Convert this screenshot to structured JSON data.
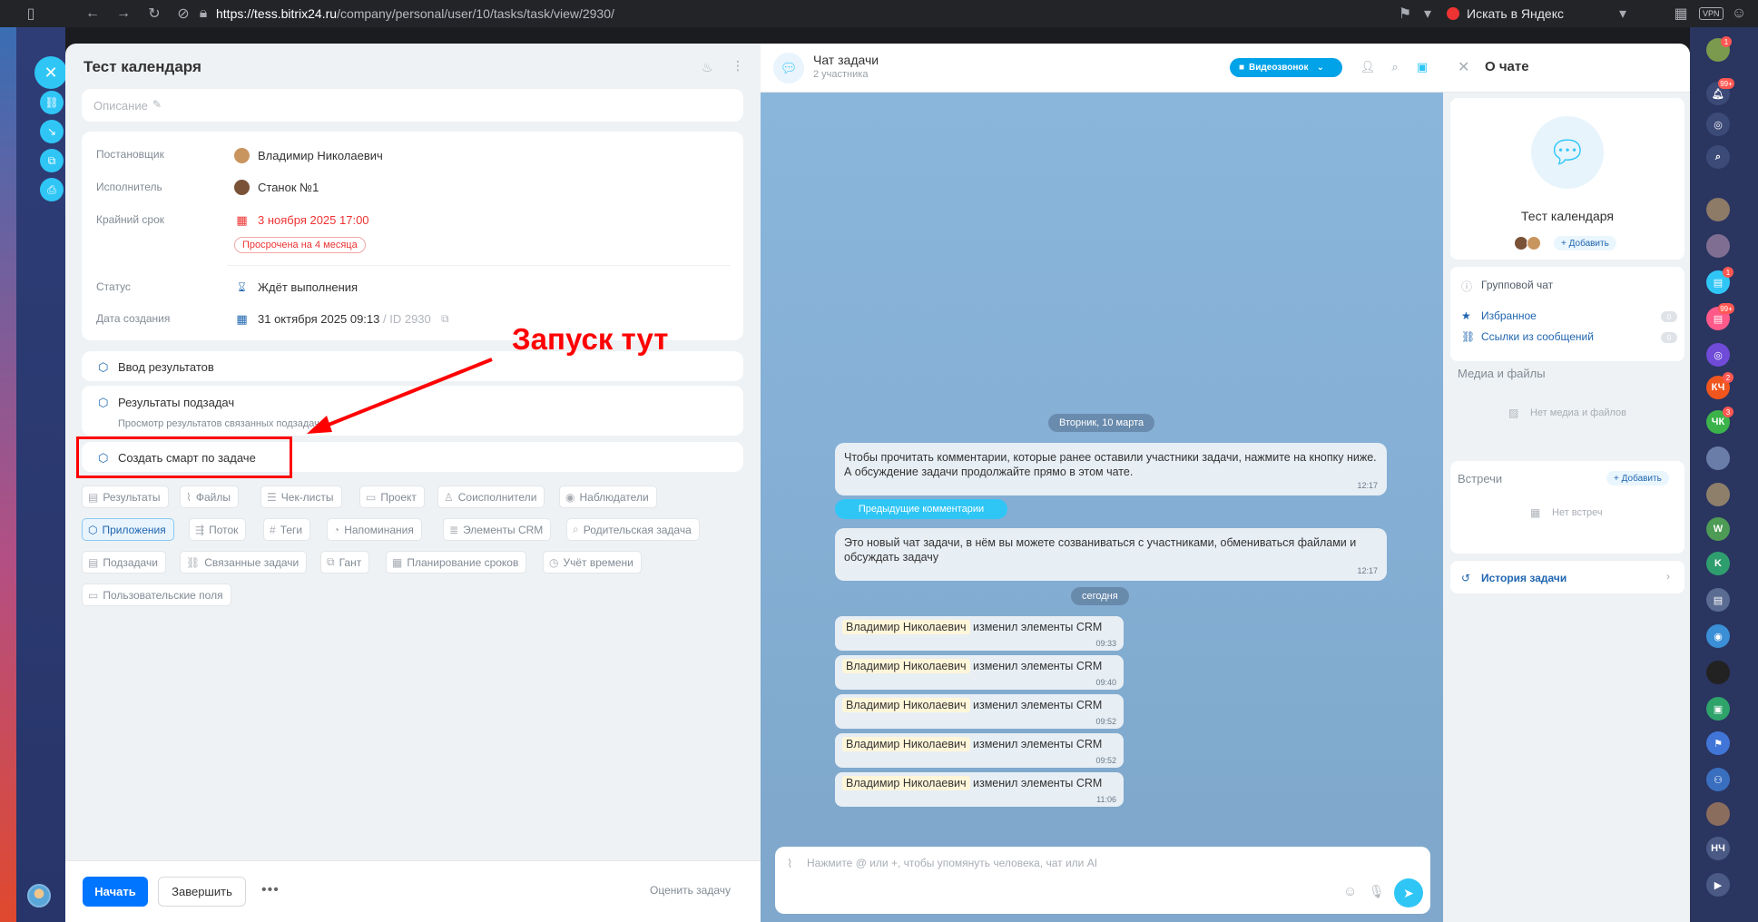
{
  "browser": {
    "url_host": "https://tess.bitrix24.ru",
    "url_path": "/company/personal/user/10/tasks/task/view/2930/",
    "search_engine": "Искать в Яндекс",
    "vpn": "VPN"
  },
  "task": {
    "title": "Тест календаря",
    "description_placeholder": "Описание",
    "fields": {
      "creator_label": "Постановщик",
      "creator_value": "Владимир Николаевич",
      "assignee_label": "Исполнитель",
      "assignee_value": "Станок №1",
      "deadline_label": "Крайний срок",
      "deadline_value": "3 ноября 2025 17:00",
      "overdue_badge": "Просрочена на 4 месяца",
      "status_label": "Статус",
      "status_value": "Ждёт выполнения",
      "created_label": "Дата создания",
      "created_value": "31 октября 2025 09:13",
      "id_value": "/ ID 2930"
    },
    "blocks": {
      "results_input": "Ввод результатов",
      "subtask_results": "Результаты подзадач",
      "subtask_results_sub": "Просмотр результатов связанных подзадач",
      "create_smart": "Создать смарт по задаче"
    },
    "annotation": "Запуск тут",
    "chips_row1": [
      "Результаты",
      "Файлы",
      "Чек-листы",
      "Проект",
      "Соисполнители",
      "Наблюдатели"
    ],
    "chips_row2": [
      "Приложения",
      "Поток",
      "Теги",
      "Напоминания",
      "Элементы CRM",
      "Родительская задача"
    ],
    "chips_row3": [
      "Подзадачи",
      "Связанные задачи",
      "Гант",
      "Планирование сроков",
      "Учёт времени"
    ],
    "chips_row4": [
      "Пользовательские поля"
    ],
    "footer": {
      "start": "Начать",
      "finish": "Завершить",
      "more": "•••",
      "rate": "Оценить задачу"
    }
  },
  "chat": {
    "title": "Чат задачи",
    "subtitle": "2 участника",
    "video_button": "Видеозвонок",
    "date_1": "Вторник, 10 марта",
    "msg_1": "Чтобы прочитать комментарии, которые ранее оставили участники задачи, нажмите на кнопку ниже. А обсуждение задачи продолжайте прямо в этом чате.",
    "msg_1_time": "12:17",
    "prev_comments": "Предыдущие комментарии",
    "msg_2": "Это новый чат задачи, в нём вы можете созваниваться с участниками, обмениваться файлами и обсуждать задачу",
    "msg_2_time": "12:17",
    "date_2": "сегодня",
    "crm_author": "Владимир Николаевич",
    "crm_action": "изменил элементы CRM",
    "crm_times": [
      "09:33",
      "09:40",
      "09:52",
      "09:52",
      "11:06"
    ],
    "input_placeholder": "Нажмите @ или +, чтобы упомянуть человека, чат или AI"
  },
  "about": {
    "title": "О чате",
    "chat_name": "Тест календаря",
    "add": "+ Добавить",
    "group_chat": "Групповой чат",
    "favorites": "Избранное",
    "favorites_count": "0",
    "links": "Ссылки из сообщений",
    "links_count": "0",
    "media_title": "Медиа и файлы",
    "media_empty": "Нет медиа и файлов",
    "meetings_title": "Встречи",
    "meetings_add": "+ Добавить",
    "meetings_empty": "Нет встреч",
    "history": "История задачи"
  },
  "rightbar": {
    "badges": [
      "1",
      "99+",
      "1",
      "99+",
      "2",
      "3"
    ],
    "initials": [
      "КЧ",
      "ЧК",
      "НЧ"
    ]
  },
  "colors": {
    "accent": "#0075ff",
    "link": "#2066b0",
    "chat_accent": "#2fc6f6",
    "danger": "#ff0000"
  }
}
